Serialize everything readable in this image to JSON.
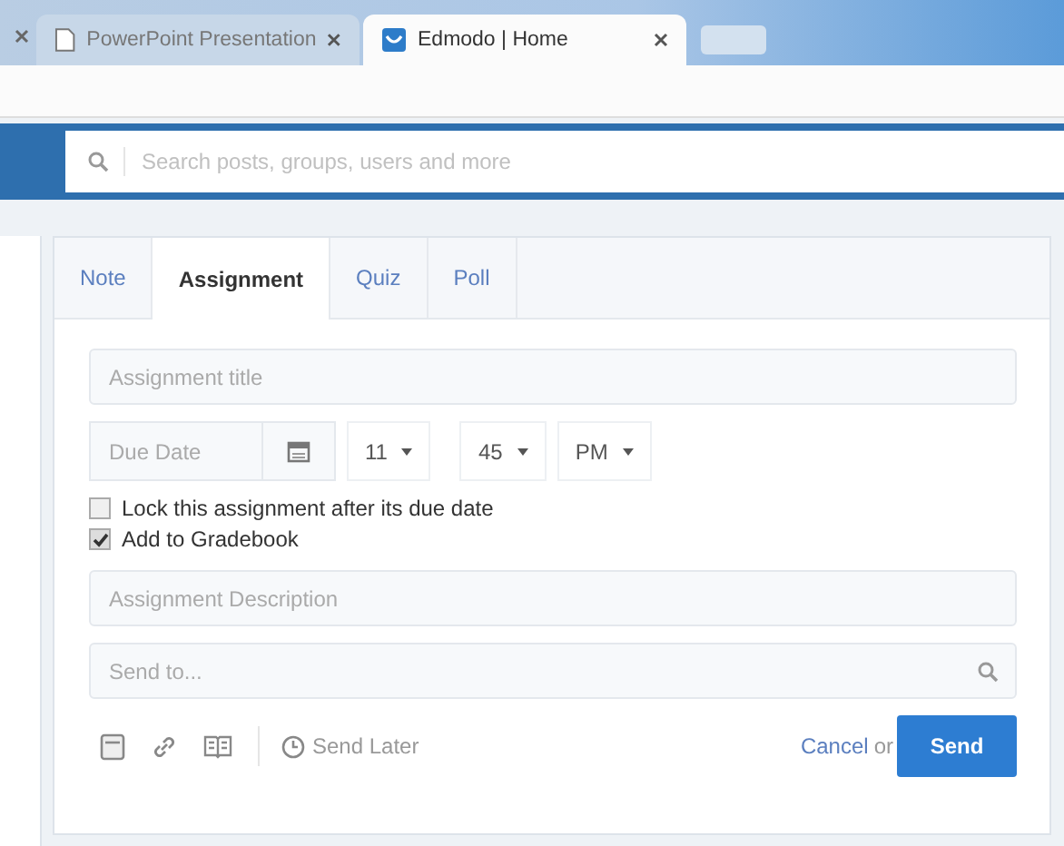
{
  "browser_tabs": [
    {
      "title": "PowerPoint Presentation",
      "selected": false
    },
    {
      "title": "Edmodo | Home",
      "selected": true
    }
  ],
  "search": {
    "placeholder": "Search posts, groups, users and more"
  },
  "composer_tabs": [
    {
      "label": "Note",
      "selected": false
    },
    {
      "label": "Assignment",
      "selected": true
    },
    {
      "label": "Quiz",
      "selected": false
    },
    {
      "label": "Poll",
      "selected": false
    }
  ],
  "title_field": {
    "placeholder": "Assignment title"
  },
  "due_date": {
    "placeholder": "Due Date",
    "hour": "11",
    "minute": "45",
    "ampm": "PM"
  },
  "options": [
    {
      "label": "Lock this assignment after its due date",
      "checked": false
    },
    {
      "label": "Add to Gradebook",
      "checked": true
    }
  ],
  "description": {
    "placeholder": "Assignment Description"
  },
  "send_to": {
    "placeholder": "Send to..."
  },
  "footer": {
    "send_later": "Send Later",
    "cancel": "Cancel",
    "or": "or",
    "send": "Send"
  }
}
